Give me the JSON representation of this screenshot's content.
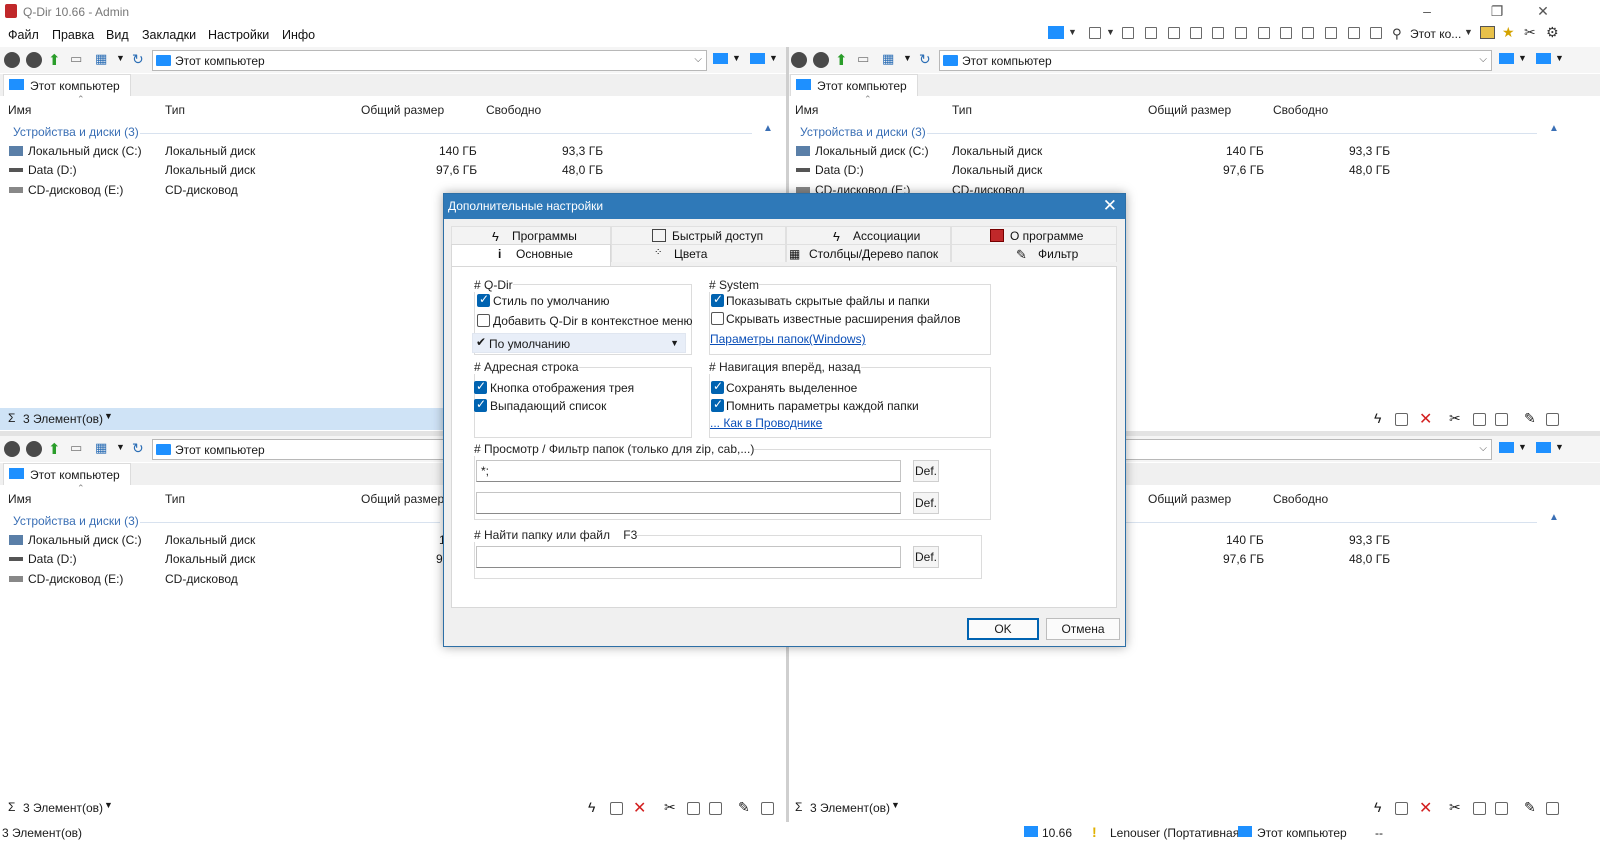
{
  "app": {
    "title": "Q-Dir 10.66 - Admin"
  },
  "menu": {
    "file": "Файл",
    "edit": "Правка",
    "view": "Вид",
    "bookmarks": "Закладки",
    "settings": "Настройки",
    "info": "Инфо"
  },
  "top_toolbar": {
    "computer_label": "Этот ко..."
  },
  "pane": {
    "address": "Этот компьютер",
    "tab_label": "Этот компьютер",
    "columns": {
      "name": "Имя",
      "type": "Тип",
      "total": "Общий размер",
      "free": "Свободно"
    },
    "group": "Устройства и диски (3)",
    "rows": [
      {
        "name": "Локальный диск (C:)",
        "type": "Локальный диск",
        "total": "140 ГБ",
        "free": "93,3 ГБ"
      },
      {
        "name": "Data (D:)",
        "type": "Локальный диск",
        "total": "97,6 ГБ",
        "free": "48,0 ГБ"
      },
      {
        "name": "CD-дисковод (E:)",
        "type": "CD-дисковод",
        "total": "",
        "free": ""
      }
    ],
    "status": "3 Элемент(ов)",
    "sigma": "Σ"
  },
  "partial_columns": {
    "total": "Общий размер",
    "free": "Свободно"
  },
  "partial_row_truncated": "CD-дисковод (E:)",
  "partial_type_truncated": "CD-дисковод",
  "partial_total_c": "1",
  "partial_total_d": "9",
  "dialog": {
    "title": "Дополнительные настройки",
    "tabs": {
      "programs": "Программы",
      "quick_access": "Быстрый доступ",
      "associations": "Ассоциации",
      "about": "О программе",
      "general": "Основные",
      "colors": "Цвета",
      "columns_tree": "Столбцы/Дерево папок",
      "filter": "Фильтр"
    },
    "qdir": {
      "title": "# Q-Dir",
      "default_style": "Стиль по умолчанию",
      "add_context_menu": "Добавить Q-Dir в контекстное меню",
      "default_option": "По умолчанию"
    },
    "system": {
      "title": "# System",
      "show_hidden": "Показывать скрытые файлы и папки",
      "hide_extensions": "Скрывать известные расширения файлов",
      "folder_options_link": "Параметры папок(Windows)"
    },
    "address_bar": {
      "title": "# Адресная строка",
      "tray_button": "Кнопка отображения трея",
      "dropdown": "Выпадающий список"
    },
    "navigation": {
      "title": "# Навигация вперёд, назад",
      "save_selected": "Сохранять выделенное",
      "remember_params": "Помнить параметры каждой папки",
      "explorer_link": "... Как в Проводнике"
    },
    "preview_filter": {
      "title": "# Просмотр / Фильтр папок (только для zip, cab,...)",
      "field1": "*;",
      "field2": "",
      "def": "Def."
    },
    "find": {
      "title": "# Найти папку или файл    F3",
      "field": "",
      "def": "Def."
    },
    "ok": "OK",
    "cancel": "Отмена"
  },
  "bottom_status": {
    "items": "3 Элемент(ов)",
    "version": "10.66",
    "user": "Lenouser (Портативная",
    "computer": "Этот компьютер",
    "dashes": "--"
  }
}
